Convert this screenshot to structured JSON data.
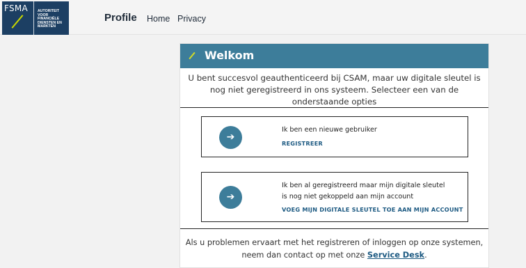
{
  "logo": {
    "abbr": "FSMA",
    "lines": [
      "AUTORITEIT",
      "VOOR",
      "FINANCIËLE",
      "DIENSTEN EN",
      "MARKTEN"
    ]
  },
  "nav": {
    "brand": "Profile",
    "home": "Home",
    "privacy": "Privacy"
  },
  "card": {
    "title": "Welkom",
    "intro": "U bent succesvol geauthenticeerd bij CSAM, maar uw digitale sleutel is nog niet geregistreerd in ons systeem. Selecteer een van de onderstaande opties",
    "options": [
      {
        "arrow": "➔",
        "text": "Ik ben een nieuwe gebruiker",
        "link": "REGISTREER"
      },
      {
        "arrow": "➔",
        "text_line1": "Ik ben al geregistreerd maar mijn digitale sleutel",
        "text_line2": "is nog niet gekoppeld aan mijn account",
        "link": "VOEG MIJN DIGITALE SLEUTEL TOE AAN MIJN ACCOUNT"
      }
    ],
    "footer_before": "Als u problemen ervaart met het registreren of inloggen op onze systemen, neem dan contact op met onze ",
    "footer_link": "Service Desk",
    "footer_after": "."
  },
  "colors": {
    "header_bg": "#3d7d9a",
    "accent_yellow": "#d4dc25",
    "logo_bg": "#1c3f63",
    "link": "#1d5a82"
  }
}
